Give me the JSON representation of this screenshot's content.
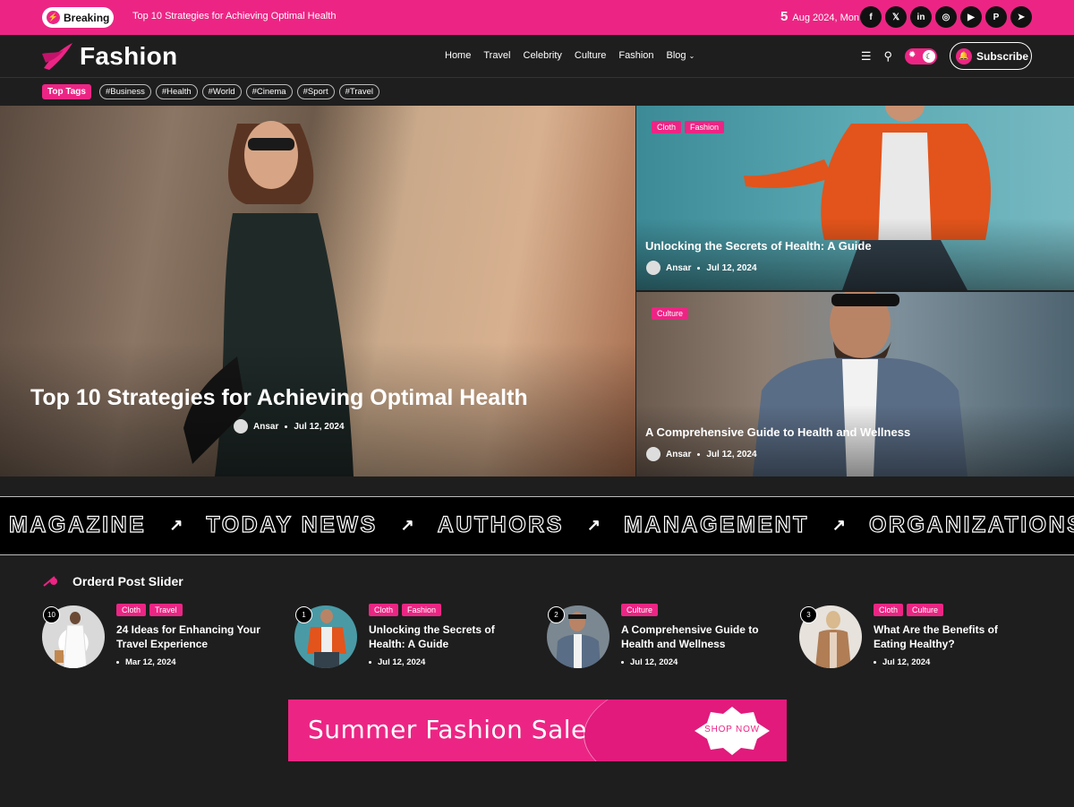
{
  "colors": {
    "accent": "#ec2584",
    "background": "#1e1e1e",
    "topbar": "#ec2584"
  },
  "topbar": {
    "breaking_label": "Breaking",
    "headline": "Top 10 Strategies for Achieving Optimal Health",
    "date_day": "5",
    "date_rest": "Aug 2024, Mon",
    "socials": [
      {
        "icon": "facebook-icon",
        "glyph": "f"
      },
      {
        "icon": "x-icon",
        "glyph": "𝕏"
      },
      {
        "icon": "linkedin-icon",
        "glyph": "in"
      },
      {
        "icon": "instagram-icon",
        "glyph": "◎"
      },
      {
        "icon": "youtube-icon",
        "glyph": "▶"
      },
      {
        "icon": "pinterest-icon",
        "glyph": "P"
      },
      {
        "icon": "telegram-icon",
        "glyph": "➤"
      }
    ]
  },
  "header": {
    "logo": "Fashion",
    "nav": [
      "Home",
      "Travel",
      "Celebrity",
      "Culture",
      "Fashion",
      "Blog"
    ],
    "subscribe_label": "Subscribe"
  },
  "tags": {
    "label": "Top Tags",
    "items": [
      "Business",
      "Health",
      "World",
      "Cinema",
      "Sport",
      "Travel"
    ]
  },
  "hero": {
    "main": {
      "title": "Top 10 Strategies for Achieving Optimal Health",
      "author": "Ansar",
      "date": "Jul 12, 2024"
    },
    "side": [
      {
        "badges": [
          "Cloth",
          "Fashion"
        ],
        "title": "Unlocking the Secrets of Health: A Guide",
        "author": "Ansar",
        "date": "Jul 12, 2024"
      },
      {
        "badges": [
          "Culture"
        ],
        "title": "A Comprehensive Guide to Health and Wellness",
        "author": "Ansar",
        "date": "Jul 12, 2024"
      }
    ]
  },
  "marquee": [
    "MAGAZINE",
    "TODAY NEWS",
    "AUTHORS",
    "MANAGEMENT",
    "ORGANIZATIONS"
  ],
  "ordered": {
    "title": "Orderd Post Slider",
    "posts": [
      {
        "num": "10",
        "badges": [
          "Cloth",
          "Travel"
        ],
        "title": "24 Ideas for Enhancing Your Travel Experience",
        "date": "Mar 12, 2024"
      },
      {
        "num": "1",
        "badges": [
          "Cloth",
          "Fashion"
        ],
        "title": "Unlocking the Secrets of Health: A Guide",
        "date": "Jul 12, 2024"
      },
      {
        "num": "2",
        "badges": [
          "Culture"
        ],
        "title": "A Comprehensive Guide to Health and Wellness",
        "date": "Jul 12, 2024"
      },
      {
        "num": "3",
        "badges": [
          "Cloth",
          "Culture"
        ],
        "title": "What Are the Benefits of Eating Healthy?",
        "date": "Jul 12, 2024"
      }
    ]
  },
  "banner": {
    "text": "Summer Fashion Sale",
    "button": "SHOP NOW"
  }
}
